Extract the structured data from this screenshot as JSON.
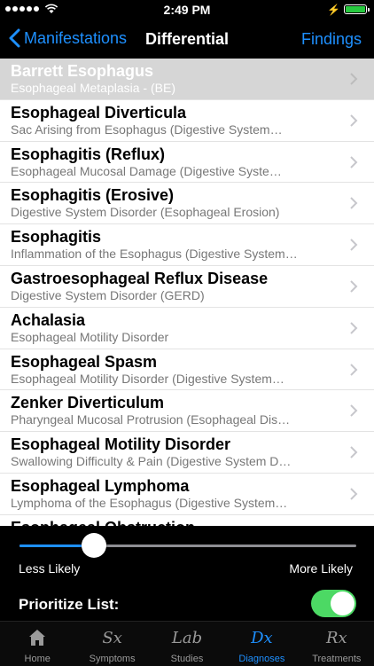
{
  "status_bar": {
    "time": "2:49 PM"
  },
  "nav": {
    "back_label": "Manifestations",
    "title": "Differential",
    "right_label": "Findings"
  },
  "list": {
    "selected_index": 0,
    "items": [
      {
        "title": "Barrett Esophagus",
        "subtitle": "Esophageal Metaplasia  - (BE)"
      },
      {
        "title": "Esophageal Diverticula",
        "subtitle": "Sac Arising from Esophagus (Digestive System…"
      },
      {
        "title": "Esophagitis (Reflux)",
        "subtitle": "Esophageal Mucosal Damage (Digestive Syste…"
      },
      {
        "title": "Esophagitis (Erosive)",
        "subtitle": "Digestive System Disorder (Esophageal Erosion)"
      },
      {
        "title": "Esophagitis",
        "subtitle": "Inflammation of the Esophagus (Digestive System…"
      },
      {
        "title": "Gastroesophageal Reflux Disease",
        "subtitle": "Digestive System Disorder (GERD)"
      },
      {
        "title": "Achalasia",
        "subtitle": "Esophageal Motility Disorder"
      },
      {
        "title": "Esophageal Spasm",
        "subtitle": "Esophageal Motility Disorder (Digestive System…"
      },
      {
        "title": "Zenker Diverticulum",
        "subtitle": "Pharyngeal Mucosal Protrusion (Esophageal Dis…"
      },
      {
        "title": "Esophageal Motility Disorder",
        "subtitle": "Swallowing Difficulty & Pain (Digestive System D…"
      },
      {
        "title": "Esophageal Lymphoma",
        "subtitle": "Lymphoma of the Esophagus (Digestive System…"
      },
      {
        "title": "Esophageal Obstruction",
        "subtitle": ""
      }
    ]
  },
  "slider": {
    "left_label": "Less Likely",
    "right_label": "More Likely",
    "value": 0.2
  },
  "prioritize": {
    "label": "Prioritize List:",
    "on": true
  },
  "tabs": [
    {
      "label": "Home",
      "icon": "house-icon",
      "glyph": "",
      "active": false
    },
    {
      "label": "Symptoms",
      "icon": "sx-icon",
      "glyph": "Sx",
      "active": false
    },
    {
      "label": "Studies",
      "icon": "lab-icon",
      "glyph": "Lab",
      "active": false
    },
    {
      "label": "Diagnoses",
      "icon": "dx-icon",
      "glyph": "Dx",
      "active": true
    },
    {
      "label": "Treatments",
      "icon": "rx-icon",
      "glyph": "Rx",
      "active": false
    }
  ],
  "colors": {
    "accent": "#1e90ff",
    "toggle_on": "#4cd964",
    "battery": "#27c93f",
    "selected_row": "#d6d6d6"
  }
}
